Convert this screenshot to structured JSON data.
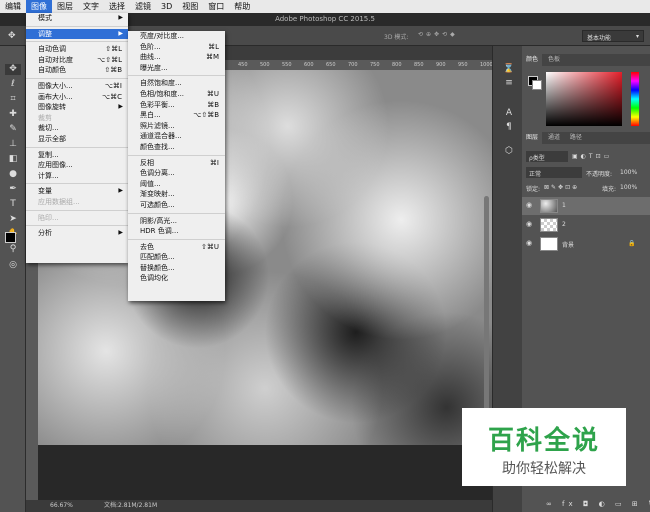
{
  "menubar": {
    "items": [
      "编辑",
      "图像",
      "图层",
      "文字",
      "选择",
      "滤镜",
      "3D",
      "视图",
      "窗口",
      "帮助"
    ],
    "active_index": 1
  },
  "titlebar": {
    "title": "Adobe Photoshop CC 2015.5"
  },
  "optbar": {
    "mode_label": "3D 模式:",
    "workspace": "基本功能"
  },
  "image_menu": {
    "items": [
      {
        "label": "模式",
        "submenu": true
      },
      {
        "sep": true
      },
      {
        "label": "调整",
        "submenu": true,
        "highlight": true
      },
      {
        "sep": true
      },
      {
        "label": "自动色调",
        "shortcut": "⇧⌘L"
      },
      {
        "label": "自动对比度",
        "shortcut": "⌥⇧⌘L"
      },
      {
        "label": "自动颜色",
        "shortcut": "⇧⌘B"
      },
      {
        "sep": true
      },
      {
        "label": "图像大小...",
        "shortcut": "⌥⌘I"
      },
      {
        "label": "画布大小...",
        "shortcut": "⌥⌘C"
      },
      {
        "label": "图像旋转",
        "submenu": true
      },
      {
        "label": "裁剪",
        "disabled": true
      },
      {
        "label": "裁切..."
      },
      {
        "label": "显示全部"
      },
      {
        "sep": true
      },
      {
        "label": "复制..."
      },
      {
        "label": "应用图像..."
      },
      {
        "label": "计算..."
      },
      {
        "sep": true
      },
      {
        "label": "变量",
        "submenu": true
      },
      {
        "label": "应用数据组...",
        "disabled": true
      },
      {
        "sep": true
      },
      {
        "label": "陷印...",
        "disabled": true
      },
      {
        "sep": true
      },
      {
        "label": "分析",
        "submenu": true
      }
    ]
  },
  "adjust_menu": {
    "items": [
      {
        "label": "亮度/对比度..."
      },
      {
        "label": "色阶...",
        "shortcut": "⌘L"
      },
      {
        "label": "曲线...",
        "shortcut": "⌘M"
      },
      {
        "label": "曝光度..."
      },
      {
        "sep": true
      },
      {
        "label": "自然饱和度..."
      },
      {
        "label": "色相/饱和度...",
        "shortcut": "⌘U"
      },
      {
        "label": "色彩平衡...",
        "shortcut": "⌘B"
      },
      {
        "label": "黑白...",
        "shortcut": "⌥⇧⌘B"
      },
      {
        "label": "照片滤镜..."
      },
      {
        "label": "通道混合器..."
      },
      {
        "label": "颜色查找..."
      },
      {
        "sep": true
      },
      {
        "label": "反相",
        "shortcut": "⌘I"
      },
      {
        "label": "色调分离..."
      },
      {
        "label": "阈值..."
      },
      {
        "label": "渐变映射..."
      },
      {
        "label": "可选颜色..."
      },
      {
        "sep": true
      },
      {
        "label": "阴影/高光..."
      },
      {
        "label": "HDR 色调..."
      },
      {
        "sep": true
      },
      {
        "label": "去色",
        "shortcut": "⇧⌘U"
      },
      {
        "label": "匹配颜色..."
      },
      {
        "label": "替换颜色..."
      },
      {
        "label": "色调均化"
      }
    ]
  },
  "panels": {
    "color_tabs": [
      "颜色",
      "色板"
    ],
    "layer_tabs": [
      "图层",
      "通道",
      "路径"
    ],
    "kind_filter": "ρ类型",
    "blend_mode": "正常",
    "opacity_label": "不透明度:",
    "opacity_value": "100%",
    "lock_label": "锁定:",
    "fill_label": "填充:",
    "fill_value": "100%",
    "layers": [
      {
        "name": "1",
        "selected": true
      },
      {
        "name": "2",
        "selected": false
      },
      {
        "name": "背景",
        "selected": false
      }
    ]
  },
  "statusbar": {
    "zoom": "66.67%",
    "doc_info": "文档:2.81M/2.81M"
  },
  "ruler": {
    "ticks": [
      "450",
      "500",
      "550",
      "600",
      "650",
      "700",
      "750",
      "800",
      "850",
      "900",
      "950",
      "1000"
    ]
  },
  "watermark": {
    "line1": "百科全说",
    "line2": "助你轻松解决"
  },
  "colors": {
    "accent": "#2f6fd6",
    "watermark_green": "#2ea34b"
  }
}
